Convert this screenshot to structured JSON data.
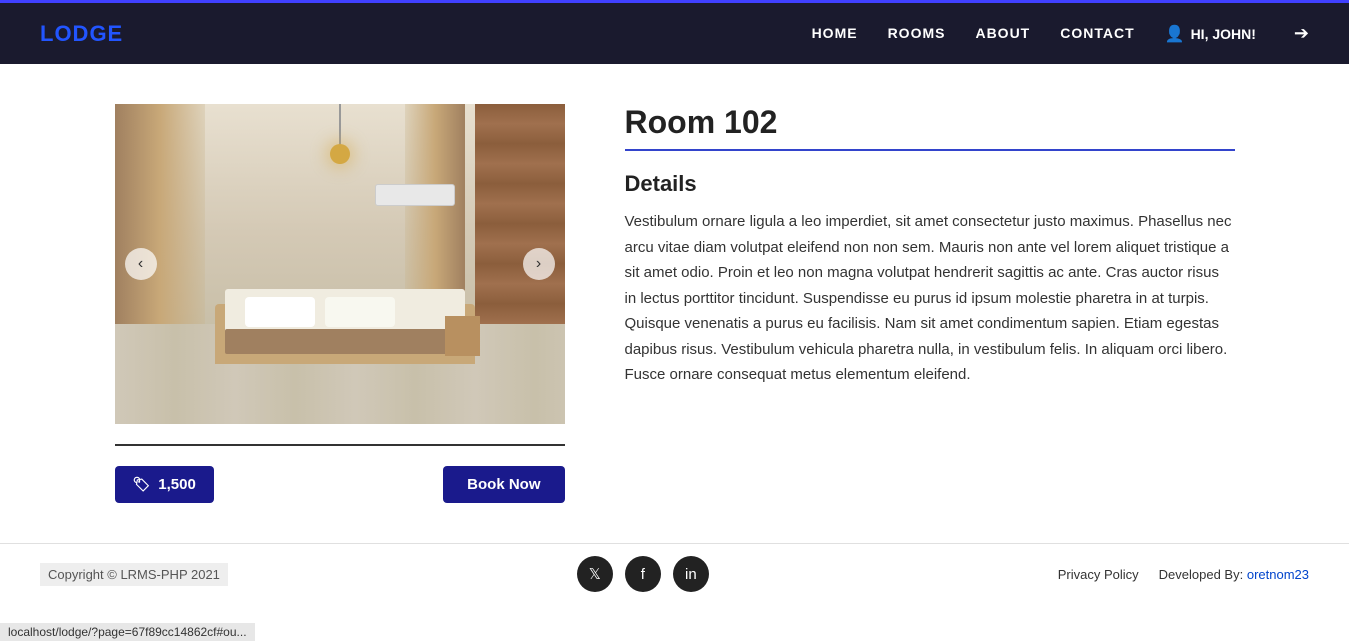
{
  "brand": "LODGE",
  "nav": {
    "home": "HOME",
    "rooms": "ROOMS",
    "about": "ABOUT",
    "contact": "CONTACT",
    "user": "HI, JOHN!"
  },
  "room": {
    "title": "Room 102",
    "details_heading": "Details",
    "description": "Vestibulum ornare ligula a leo imperdiet, sit amet consectetur justo maximus. Phasellus nec arcu vitae diam volutpat eleifend non non sem. Mauris non ante vel lorem aliquet tristique a sit amet odio. Proin et leo non magna volutpat hendrerit sagittis ac ante. Cras auctor risus in lectus porttitor tincidunt. Suspendisse eu purus id ipsum molestie pharetra in at turpis. Quisque venenatis a purus eu facilisis. Nam sit amet condimentum sapien. Etiam egestas dapibus risus. Vestibulum vehicula pharetra nulla, in vestibulum felis. In aliquam orci libero. Fusce ornare consequat metus elementum eleifend.",
    "price": "1,500",
    "book_label": "Book Now",
    "carousel_prev": "‹",
    "carousel_next": "›"
  },
  "footer": {
    "copyright": "Copyright © LRMS-PHP 2021",
    "privacy": "Privacy Policy",
    "developed_by_label": "Developed By:",
    "developer_name": "oretnom23",
    "url_hint": "localhost/lodge/?page=67f89cc14862cf#ou..."
  }
}
